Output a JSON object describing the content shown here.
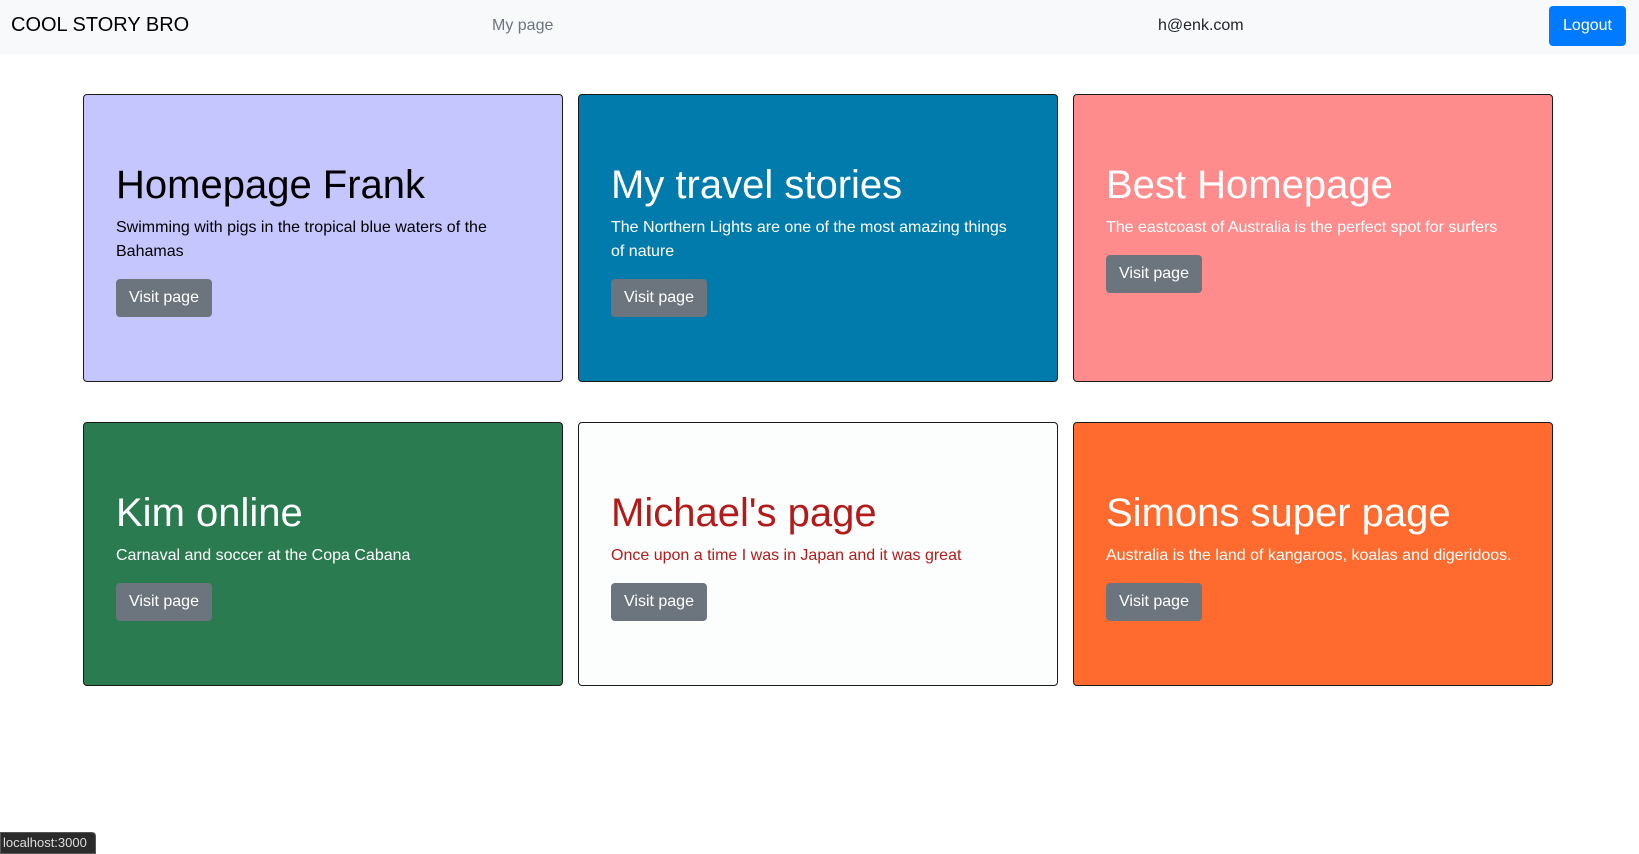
{
  "navbar": {
    "brand": "COOL STORY BRO",
    "my_page_link": "My page",
    "user_email": "h@enk.com",
    "logout_label": "Logout"
  },
  "cards": [
    {
      "title": "Homepage Frank",
      "description": "Swimming with pigs in the tropical blue waters of the Bahamas",
      "button": "Visit page",
      "background_color": "#c6c6ff",
      "text_color": "#000000"
    },
    {
      "title": "My travel stories",
      "description": "The Northern Lights are one of the most amazing things of nature",
      "button": "Visit page",
      "background_color": "#017bab",
      "text_color": "#ffffff"
    },
    {
      "title": "Best Homepage",
      "description": "The eastcoast of Australia is the perfect spot for surfers",
      "button": "Visit page",
      "background_color": "#ff8c8c",
      "text_color": "#ffffff"
    },
    {
      "title": "Kim online",
      "description": "Carnaval and soccer at the Copa Cabana",
      "button": "Visit page",
      "background_color": "#2a7b50",
      "text_color": "#ffffff"
    },
    {
      "title": "Michael's page",
      "description": "Once upon a time I was in Japan and it was great",
      "button": "Visit page",
      "background_color": "#fcfefd",
      "text_color": "#b31a1a"
    },
    {
      "title": "Simons super page",
      "description": "Australia is the land of kangaroos, koalas and digeridoos.",
      "button": "Visit page",
      "background_color": "#ff6a2e",
      "text_color": "#ffffff"
    }
  ],
  "status_bar": {
    "url": "localhost:3000"
  }
}
